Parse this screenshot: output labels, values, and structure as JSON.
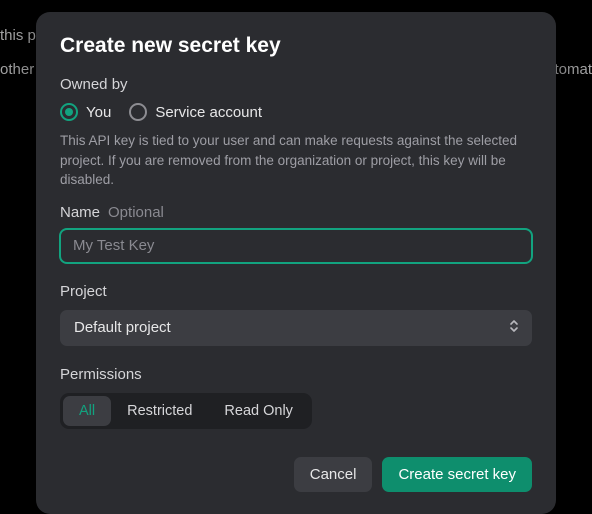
{
  "background": {
    "line1": "this pr",
    "line2_left": "other o",
    "line2_right": "tomat"
  },
  "modal": {
    "title": "Create new secret key",
    "owned_by": {
      "label": "Owned by",
      "options": {
        "you": "You",
        "service_account": "Service account"
      },
      "selected": "you",
      "help": "This API key is tied to your user and can make requests against the selected project. If you are removed from the organization or project, this key will be disabled."
    },
    "name_field": {
      "label": "Name",
      "optional": "Optional",
      "placeholder": "My Test Key",
      "value": ""
    },
    "project_field": {
      "label": "Project",
      "selected": "Default project"
    },
    "permissions": {
      "label": "Permissions",
      "options": {
        "all": "All",
        "restricted": "Restricted",
        "read_only": "Read Only"
      },
      "selected": "all"
    },
    "footer": {
      "cancel": "Cancel",
      "submit": "Create secret key"
    }
  }
}
